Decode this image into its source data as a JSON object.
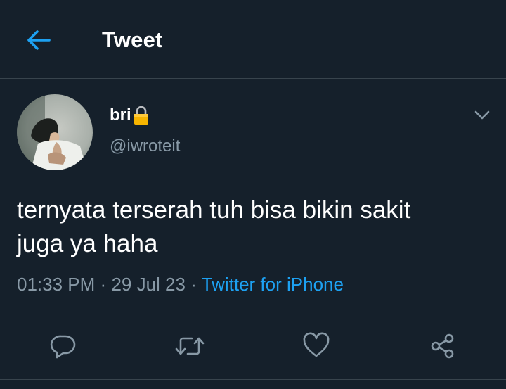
{
  "header": {
    "title": "Tweet",
    "back_icon": "arrow-left-icon"
  },
  "tweet": {
    "author": {
      "display_name": "bri",
      "name_badge_icon": "lock-icon",
      "handle": "@iwroteit",
      "avatar_icon": "avatar-photo"
    },
    "menu_icon": "chevron-down-icon",
    "text_line1": "ternyata terserah tuh bisa bikin sakit",
    "text_line2": "juga ya haha",
    "time": "01:33 PM",
    "date": "29 Jul 23",
    "separator": "·",
    "source": "Twitter for iPhone"
  },
  "actions": {
    "reply_icon": "reply-icon",
    "retweet_icon": "retweet-icon",
    "like_icon": "heart-icon",
    "share_icon": "share-icon"
  },
  "colors": {
    "background": "#15202b",
    "divider": "#38444d",
    "accent": "#1da1f2",
    "secondary_text": "#8899a6",
    "icon": "#8899a6"
  }
}
